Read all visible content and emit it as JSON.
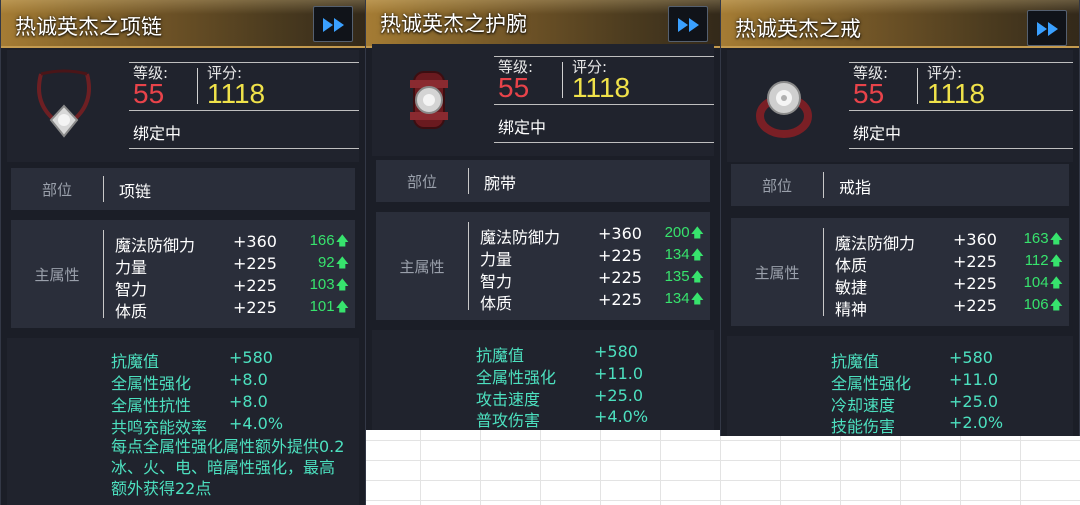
{
  "labels": {
    "level": "等级:",
    "score": "评分:",
    "bind": "绑定中",
    "slot": "部位",
    "main_attr": "主属性",
    "up_arrow": "🡅"
  },
  "colors": {
    "level_red": "#e8434a",
    "score_yellow": "#f0e24a",
    "bonus_green": "#37e36d",
    "extra_teal": "#4ce0bf",
    "title_gold": "#a57c34"
  },
  "cards": [
    {
      "title": "热诚英杰之项链",
      "level": "55",
      "score": "1118",
      "slot": "项链",
      "icon": "necklace-icon",
      "main": [
        {
          "name": "魔法防御力",
          "value": "+360",
          "bonus": "166"
        },
        {
          "name": "力量",
          "value": "+225",
          "bonus": "92"
        },
        {
          "name": "智力",
          "value": "+225",
          "bonus": "103"
        },
        {
          "name": "体质",
          "value": "+225",
          "bonus": "101"
        }
      ],
      "extra": [
        {
          "name": "抗魔值",
          "value": "+580"
        },
        {
          "name": "全属性强化",
          "value": "+8.0"
        },
        {
          "name": "全属性抗性",
          "value": "+8.0"
        },
        {
          "name": "共鸣充能效率",
          "value": "+4.0%"
        }
      ],
      "extra_text": "每点全属性强化属性额外提供0.2冰、火、电、暗属性强化，最高额外获得22点"
    },
    {
      "title": "热诚英杰之护腕",
      "level": "55",
      "score": "1118",
      "slot": "腕带",
      "icon": "bracer-icon",
      "main": [
        {
          "name": "魔法防御力",
          "value": "+360",
          "bonus": "200"
        },
        {
          "name": "力量",
          "value": "+225",
          "bonus": "134"
        },
        {
          "name": "智力",
          "value": "+225",
          "bonus": "135"
        },
        {
          "name": "体质",
          "value": "+225",
          "bonus": "134"
        }
      ],
      "extra": [
        {
          "name": "抗魔值",
          "value": "+580"
        },
        {
          "name": "全属性强化",
          "value": "+11.0"
        },
        {
          "name": "攻击速度",
          "value": "+25.0"
        },
        {
          "name": "普攻伤害",
          "value": "+4.0%"
        }
      ]
    },
    {
      "title": "热诚英杰之戒",
      "level": "55",
      "score": "1118",
      "slot": "戒指",
      "icon": "ring-icon",
      "main": [
        {
          "name": "魔法防御力",
          "value": "+360",
          "bonus": "163"
        },
        {
          "name": "体质",
          "value": "+225",
          "bonus": "112"
        },
        {
          "name": "敏捷",
          "value": "+225",
          "bonus": "104"
        },
        {
          "name": "精神",
          "value": "+225",
          "bonus": "106"
        }
      ],
      "extra": [
        {
          "name": "抗魔值",
          "value": "+580"
        },
        {
          "name": "全属性强化",
          "value": "+11.0"
        },
        {
          "name": "冷却速度",
          "value": "+25.0"
        },
        {
          "name": "技能伤害",
          "value": "+2.0%"
        }
      ]
    }
  ]
}
